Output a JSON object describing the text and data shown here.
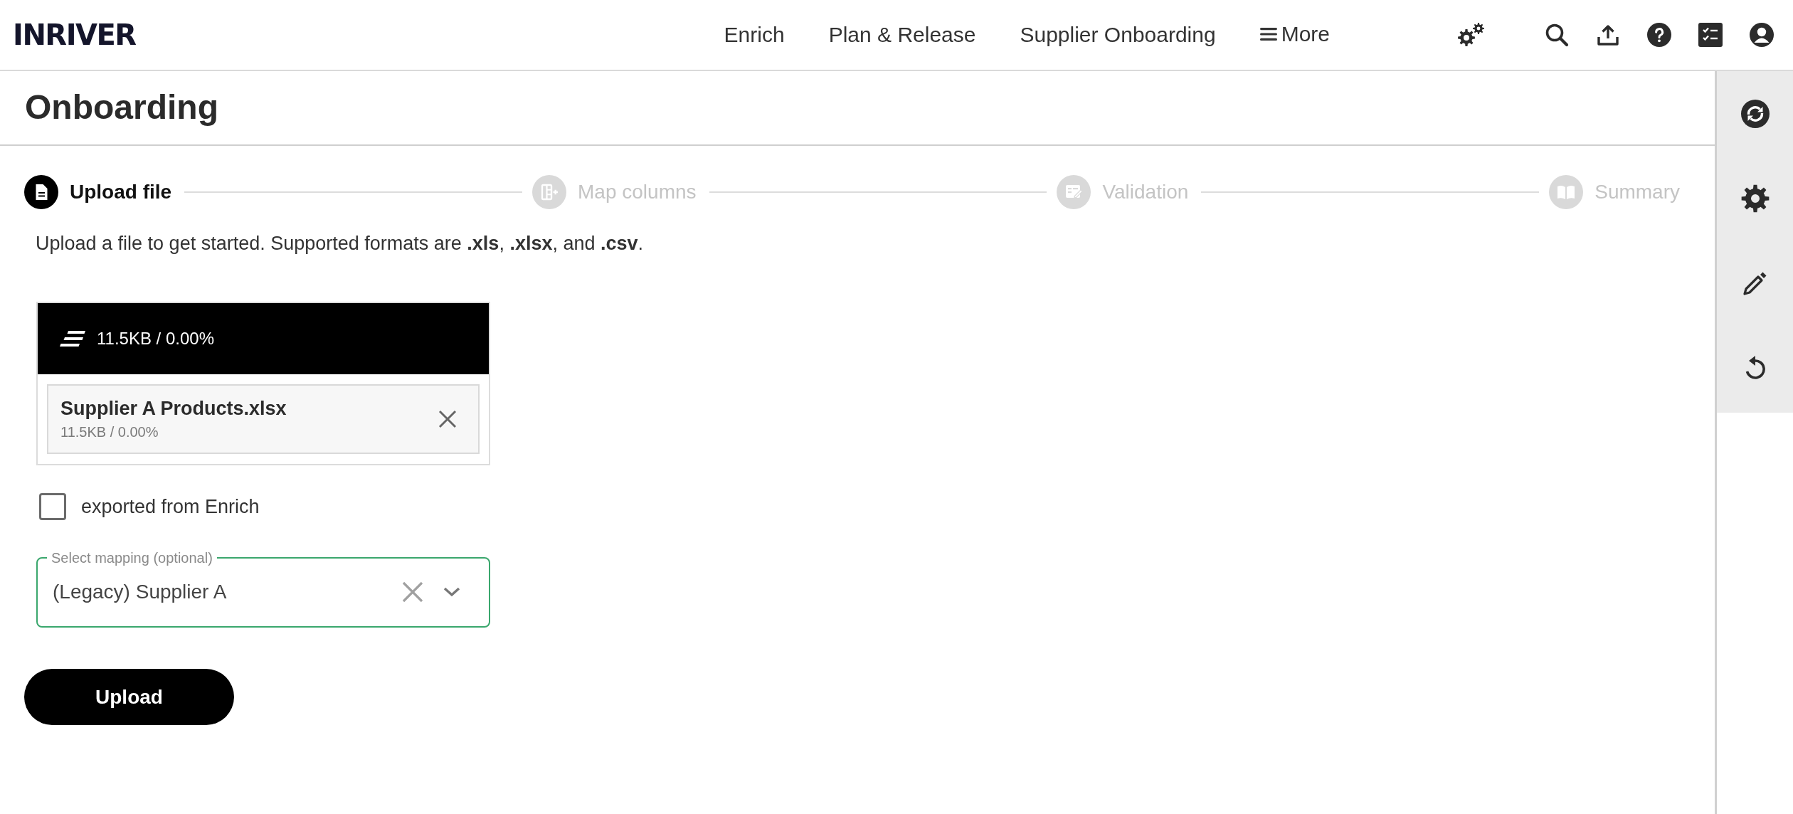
{
  "header": {
    "logo": "INRIVER",
    "nav": [
      {
        "label": "Enrich",
        "kind": "link"
      },
      {
        "label": "Plan & Release",
        "kind": "link"
      },
      {
        "label": "Supplier Onboarding",
        "kind": "link"
      },
      {
        "label": "More",
        "kind": "menu"
      }
    ]
  },
  "page": {
    "title": "Onboarding"
  },
  "stepper": {
    "steps": [
      {
        "label": "Upload file",
        "selected": true
      },
      {
        "label": "Map columns",
        "selected": false
      },
      {
        "label": "Validation",
        "selected": false
      },
      {
        "label": "Summary",
        "selected": false
      }
    ]
  },
  "instructions": "Upload a file to get started. Supported formats are **.xls**, **.xlsx**, and **.csv**.",
  "upload": {
    "summary": "11.5KB / 0.00%",
    "files": [
      {
        "name": "Supplier A Products.xlsx",
        "size": "11.5KB / 0.00%"
      }
    ]
  },
  "exported_checkbox": {
    "label": "exported from Enrich",
    "checked": false
  },
  "mapping_select": {
    "label": "Select mapping (optional)",
    "value": "(Legacy) Supplier A"
  },
  "upload_button": {
    "label": "Upload"
  }
}
